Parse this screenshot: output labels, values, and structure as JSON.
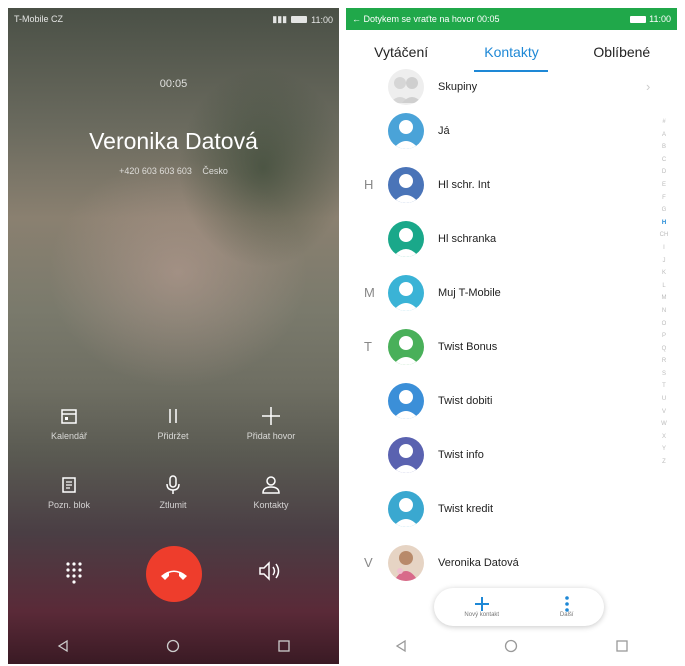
{
  "call_screen": {
    "status": {
      "carrier": "T-Mobile CZ",
      "time": "11:00"
    },
    "timer": "00:05",
    "caller_name": "Veronika Datová",
    "phone_number": "+420 603 603 603",
    "country": "Česko",
    "controls": [
      {
        "label": "Kalendář",
        "icon": "calendar-icon"
      },
      {
        "label": "Přidržet",
        "icon": "pause-icon"
      },
      {
        "label": "Přidat hovor",
        "icon": "plus-icon"
      },
      {
        "label": "Pozn. blok",
        "icon": "notepad-icon"
      },
      {
        "label": "Ztlumit",
        "icon": "microphone-icon"
      },
      {
        "label": "Kontakty",
        "icon": "person-icon"
      }
    ],
    "end_call_color": "#ee3d2c"
  },
  "contacts_screen": {
    "status": {
      "message": "Dotykem se vraťte na hovor 00:05",
      "time": "11:00",
      "color": "#20a84a"
    },
    "tabs": [
      {
        "label": "Vytáčení"
      },
      {
        "label": "Kontakty",
        "active": true
      },
      {
        "label": "Oblíbené"
      }
    ],
    "accent": "#1e88d6",
    "contacts": [
      {
        "letter": "",
        "name": "Skupiny",
        "avatar": "group-avatar"
      },
      {
        "letter": "",
        "name": "Já",
        "avatar_color": "#4aa3d8"
      },
      {
        "letter": "H",
        "name": "Hl schr. Int",
        "avatar_color": "#4a74b8"
      },
      {
        "letter": "",
        "name": "Hl schranka",
        "avatar_color": "#1aa88a"
      },
      {
        "letter": "M",
        "name": "Muj T-Mobile",
        "avatar_color": "#3ab3d6"
      },
      {
        "letter": "T",
        "name": "Twist Bonus",
        "avatar_color": "#49b05a"
      },
      {
        "letter": "",
        "name": "Twist dobiti",
        "avatar_color": "#3b8fd8"
      },
      {
        "letter": "",
        "name": "Twist info",
        "avatar_color": "#5a62b0"
      },
      {
        "letter": "",
        "name": "Twist kredit",
        "avatar_color": "#3aa8d0"
      },
      {
        "letter": "V",
        "name": "Veronika Datová",
        "avatar": "photo-avatar"
      }
    ],
    "index_letters": [
      "#",
      "A",
      "B",
      "C",
      "D",
      "E",
      "F",
      "G",
      "H",
      "CH",
      "I",
      "J",
      "K",
      "L",
      "M",
      "N",
      "O",
      "P",
      "Q",
      "R",
      "S",
      "T",
      "U",
      "V",
      "W",
      "X",
      "Y",
      "Z"
    ],
    "active_index": "H",
    "fab": [
      {
        "label": "Nový kontakt",
        "icon": "plus-icon"
      },
      {
        "label": "Další",
        "icon": "more-vertical-icon"
      }
    ]
  }
}
